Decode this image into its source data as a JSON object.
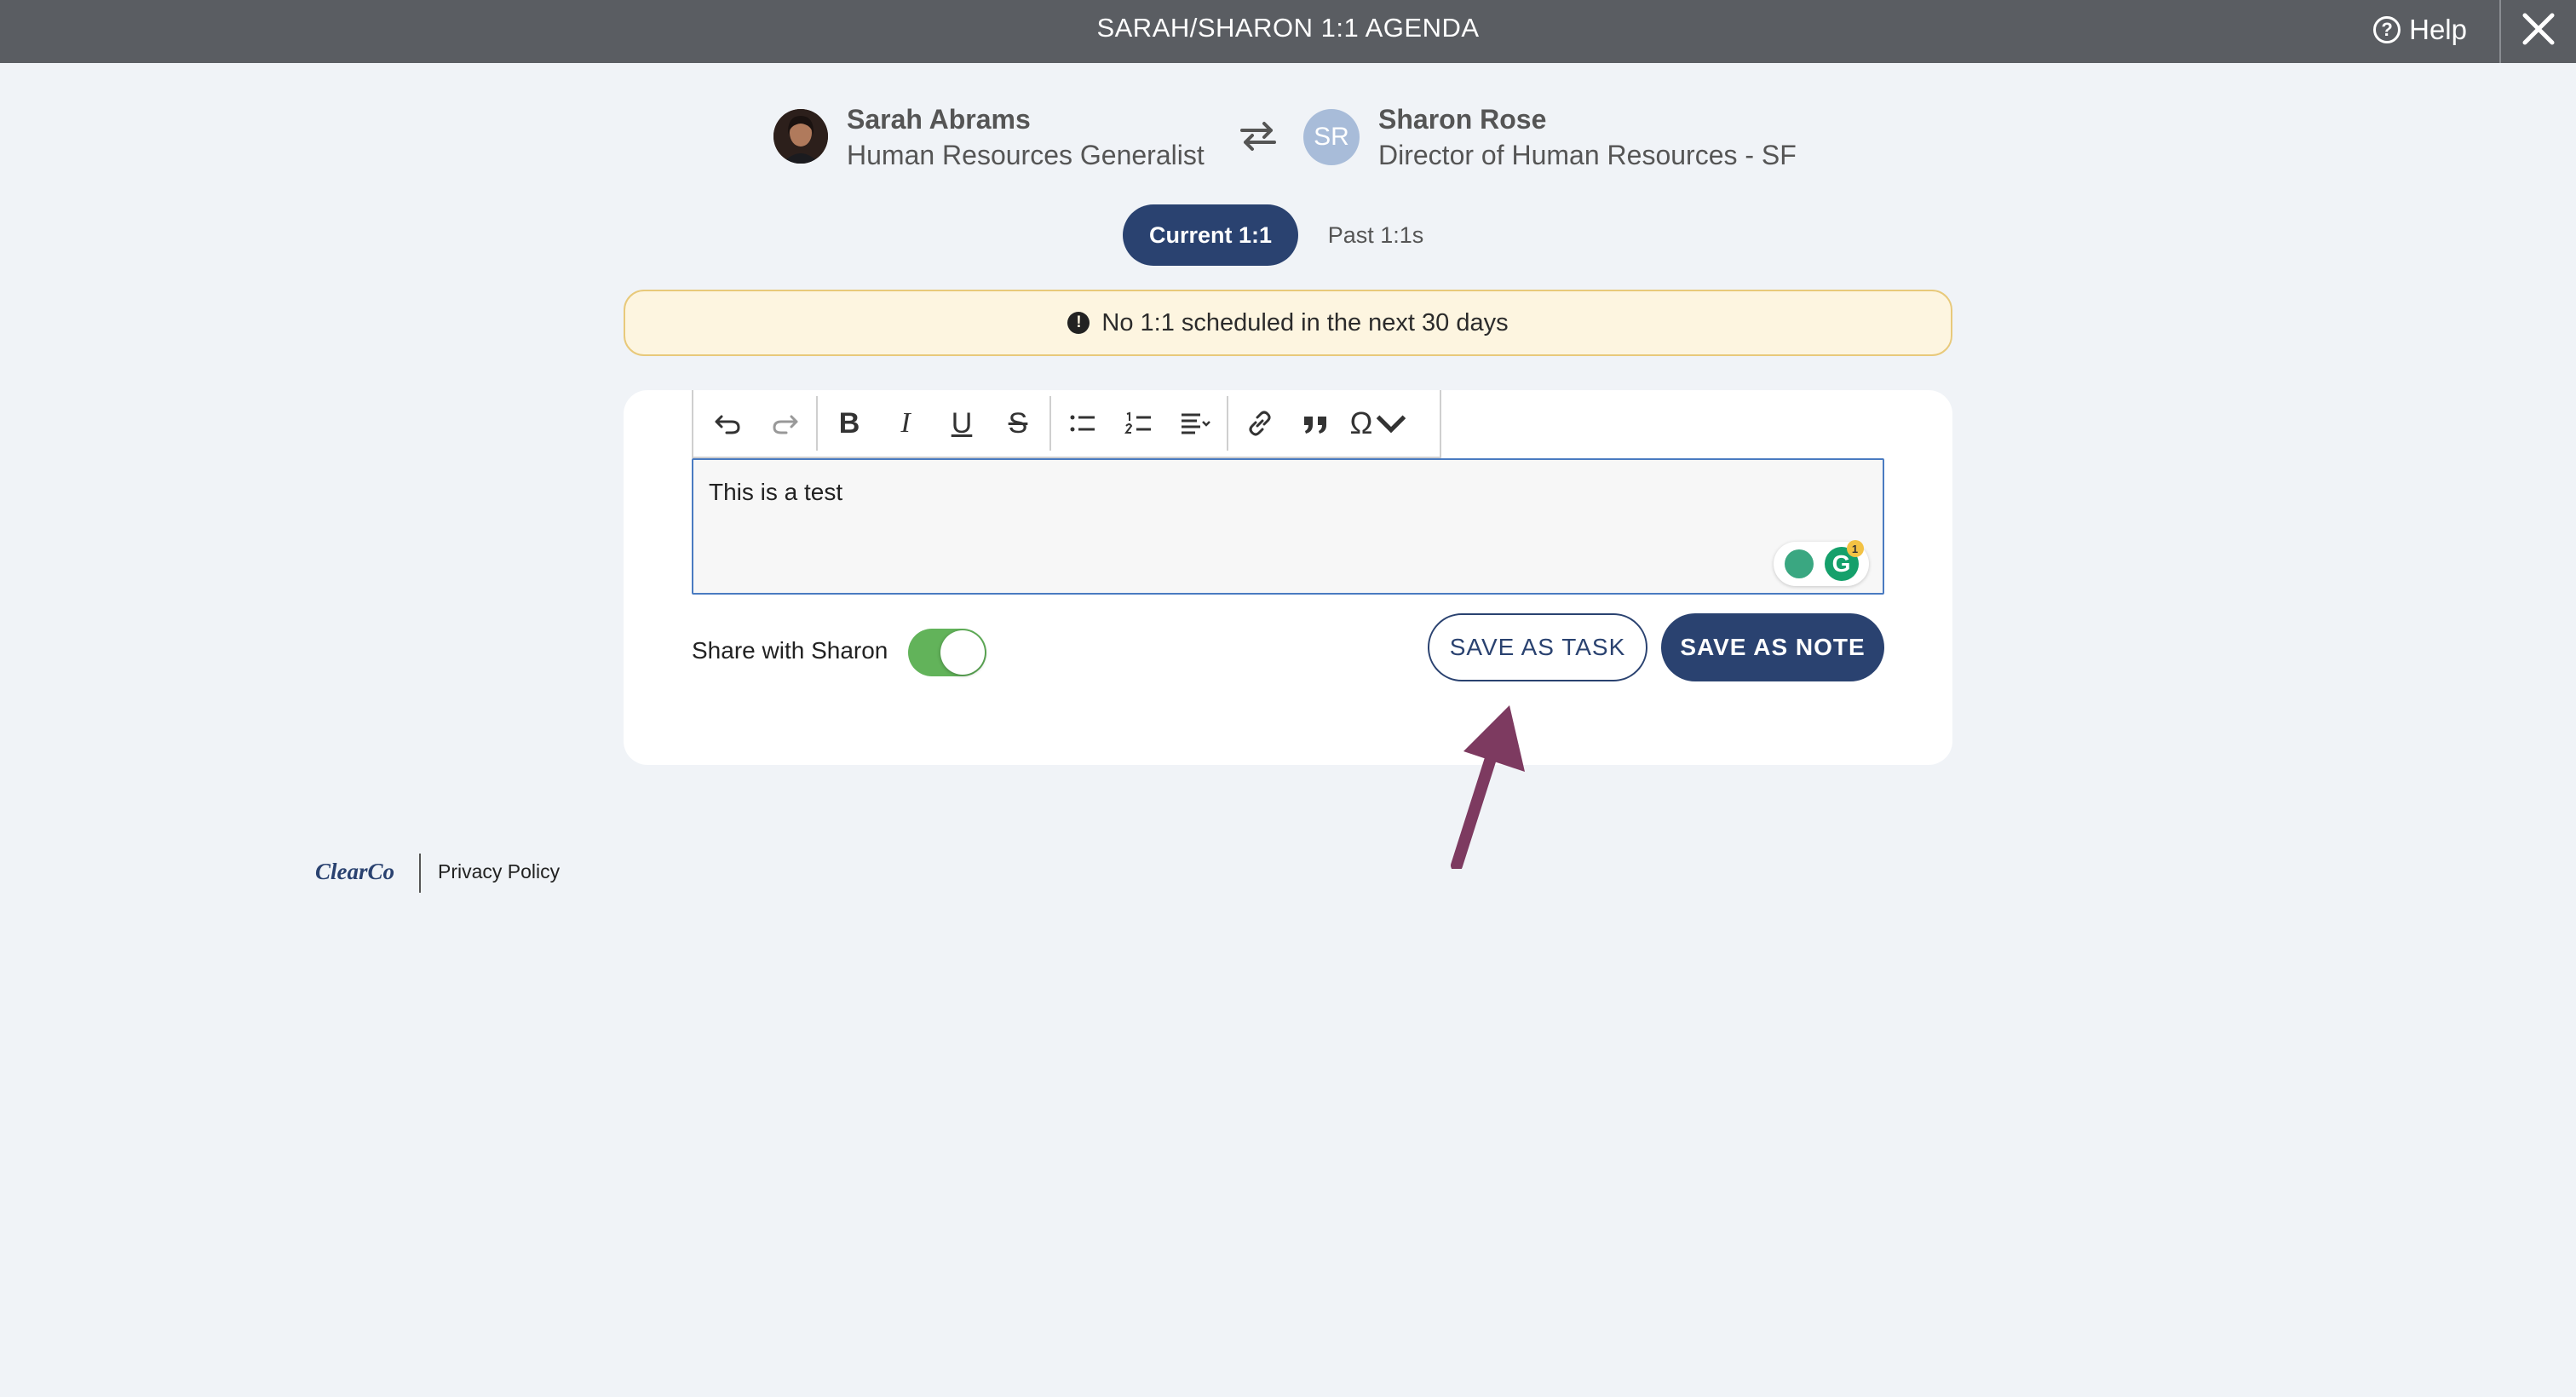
{
  "window": {
    "title": "SARAH/SHARON 1:1 AGENDA",
    "help_label": "Help",
    "help_icon": "question-circle-icon",
    "close_icon": "close-icon"
  },
  "participants": {
    "left": {
      "name": "Sarah Abrams",
      "role": "Human Resources Generalist",
      "avatar": "photo"
    },
    "swap_icon": "swap-arrows-icon",
    "right": {
      "name": "Sharon Rose",
      "role": "Director of Human Resources - SF",
      "initials": "SR"
    }
  },
  "tabs": [
    {
      "label": "Current 1:1",
      "selected": true
    },
    {
      "label": "Past 1:1s",
      "selected": false
    }
  ],
  "alert": {
    "icon": "exclamation-circle-icon",
    "text": "No 1:1 scheduled in the next 30 days"
  },
  "editor": {
    "toolbar": [
      "undo",
      "redo",
      "bold",
      "italic",
      "underline",
      "strikethrough",
      "bulleted-list",
      "numbered-list",
      "align",
      "link",
      "blockquote",
      "special-characters"
    ],
    "content": "This is a test",
    "grammarly_badge_count": "1"
  },
  "share": {
    "label": "Share with Sharon",
    "enabled": true
  },
  "actions": {
    "save_task": "SAVE AS TASK",
    "save_note": "SAVE AS NOTE"
  },
  "footer": {
    "logo": "ClearCo",
    "privacy": "Privacy Policy"
  },
  "colors": {
    "topbar": "#5a5d62",
    "primary": "#2a4270",
    "toggle_on": "#62b35a",
    "alert_bg": "#fdf5e0",
    "annotation_arrow": "#7d3a60"
  }
}
